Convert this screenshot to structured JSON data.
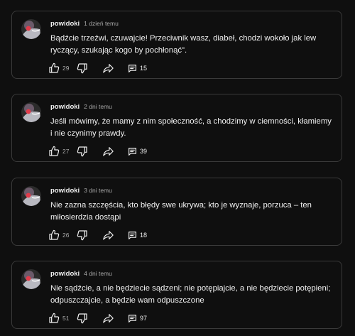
{
  "colors": {
    "background": "#0f0f0f",
    "card_border": "#3a3a3a",
    "text_primary": "#f1f1f1",
    "text_secondary": "#aaaaaa"
  },
  "icons": {
    "like": "thumbs-up-icon",
    "dislike": "thumbs-down-icon",
    "share": "share-arrow-icon",
    "replies": "comment-icon"
  },
  "posts": [
    {
      "author": "powidoki",
      "time": "1 dzień temu",
      "text": "Bądźcie trzeźwi, czuwajcie! Przeciwnik wasz, diabeł, chodzi wokoło jak lew ryczący, szukając kogo by pochłonąć\".",
      "likes": "29",
      "replies": "15"
    },
    {
      "author": "powidoki",
      "time": "2 dni temu",
      "text": "Jeśli mówimy, że mamy z nim społeczność, a chodzimy w ciemności, kłamiemy i nie czynimy prawdy.",
      "likes": "27",
      "replies": "39"
    },
    {
      "author": "powidoki",
      "time": "3 dni temu",
      "text": "Nie zazna szczęścia, kto błędy swe ukrywa; kto je wyznaje, porzuca – ten miłosierdzia dostąpi",
      "likes": "26",
      "replies": "18"
    },
    {
      "author": "powidoki",
      "time": "4 dni temu",
      "text": "Nie sądźcie, a nie będziecie sądzeni; nie potępiajcie, a nie będziecie potępieni; odpuszczajcie, a będzie wam odpuszczone",
      "likes": "51",
      "replies": "97"
    }
  ]
}
